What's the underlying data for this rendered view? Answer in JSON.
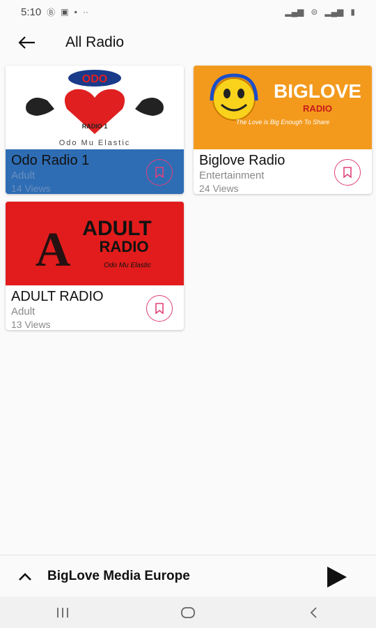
{
  "status_bar": {
    "time": "5:10",
    "icons": [
      "b-icon",
      "image-icon",
      "facebook-icon",
      "more-dots-icon"
    ],
    "right_icons": [
      "signal-icon",
      "wifi-icon",
      "signal-icon",
      "battery-icon"
    ]
  },
  "app_bar": {
    "title": "All Radio",
    "back_icon": "back-arrow-icon"
  },
  "stations": [
    {
      "name": "Odo Radio 1",
      "category": "Adult",
      "views": "14 Views",
      "logo_text": "ODO",
      "logo_sub": "RADIO 1",
      "logo_tag": "Odo Mu Elastic"
    },
    {
      "name": "Biglove Radio",
      "category": "Entertainment",
      "views": "24 Views",
      "logo_text": "BIGLOVE",
      "logo_sub": "RADIO",
      "logo_tag": "The Love is Big Enough To Share"
    },
    {
      "name": "ADULT RADIO",
      "category": "Adult",
      "views": "13 Views",
      "logo_text": "ADULT",
      "logo_sub": "RADIO",
      "logo_tag": "Odo Mu Elastic"
    }
  ],
  "player": {
    "now_playing": "BigLove Media Europe"
  },
  "colors": {
    "selected_card": "#2e6db4",
    "accent": "#e0407a"
  }
}
